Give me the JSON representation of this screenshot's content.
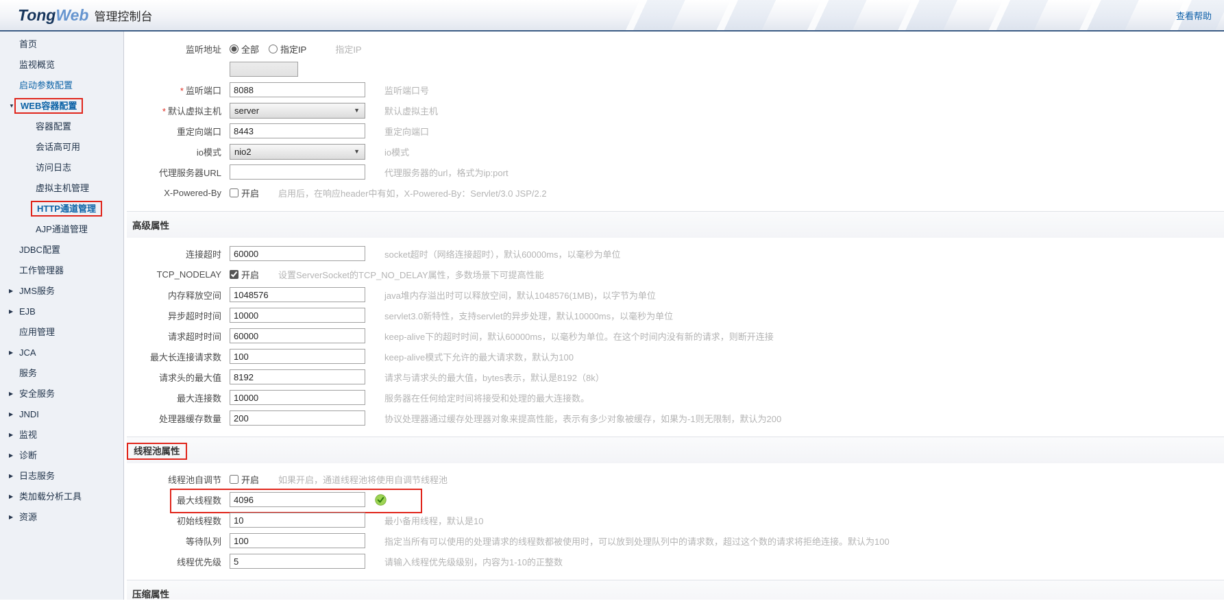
{
  "header": {
    "logo_tong": "Tong",
    "logo_web": "Web",
    "logo_suffix": "管理控制台",
    "help_link": "查看帮助"
  },
  "colors": {
    "accent_blue": "#0b62a6",
    "annotation_red": "#e0251b",
    "success_green": "#7fbf3f",
    "header_border_blue": "#3c5c85"
  },
  "sidebar": {
    "items": [
      {
        "label": "首页"
      },
      {
        "label": "监视概览"
      },
      {
        "label": "启动参数配置"
      },
      {
        "label": "WEB容器配置",
        "arrow": "▼",
        "highlighted": true
      },
      {
        "label": "容器配置"
      },
      {
        "label": "会话高可用"
      },
      {
        "label": "访问日志"
      },
      {
        "label": "虚拟主机管理"
      },
      {
        "label": "HTTP通道管理",
        "highlighted": true
      },
      {
        "label": "AJP通道管理"
      },
      {
        "label": "JDBC配置"
      },
      {
        "label": "工作管理器"
      },
      {
        "label": "JMS服务",
        "arrow": "▶"
      },
      {
        "label": "EJB",
        "arrow": "▶"
      },
      {
        "label": "应用管理"
      },
      {
        "label": "JCA",
        "arrow": "▶"
      },
      {
        "label": "服务"
      },
      {
        "label": "安全服务",
        "arrow": "▶"
      },
      {
        "label": "JNDI",
        "arrow": "▶"
      },
      {
        "label": "监视",
        "arrow": "▶"
      },
      {
        "label": "诊断",
        "arrow": "▶"
      },
      {
        "label": "日志服务",
        "arrow": "▶"
      },
      {
        "label": "类加载分析工具",
        "arrow": "▶"
      },
      {
        "label": "资源",
        "arrow": "▶"
      }
    ]
  },
  "main": {
    "groups": [
      {
        "rows": [
          {
            "label": "监听地址",
            "type": "radio",
            "help": "指定IP",
            "options": [
              {
                "label": "全部",
                "selected": true
              },
              {
                "label": "指定IP",
                "selected": false
              }
            ]
          },
          {
            "label": "",
            "type": "disabled_input",
            "value": "",
            "help": ""
          },
          {
            "label": "监听端口",
            "star": "*",
            "type": "input",
            "value": "8088",
            "help": "监听端口号"
          },
          {
            "label": "默认虚拟主机",
            "star": "*",
            "type": "select",
            "value": "server",
            "help": "默认虚拟主机"
          },
          {
            "label": "重定向端口",
            "type": "input",
            "value": "8443",
            "help": "重定向端口"
          },
          {
            "label": "io模式",
            "type": "select",
            "value": "nio2",
            "help": "io模式"
          },
          {
            "label": "代理服务器URL",
            "type": "input",
            "value": "",
            "help": "代理服务器的url，格式为ip:port"
          },
          {
            "label": "X-Powered-By",
            "type": "checkbox",
            "checkbox_label": "开启",
            "checked": false,
            "help": "启用后，在响应header中有如，X-Powered-By：Servlet/3.0 JSP/2.2"
          }
        ]
      },
      {
        "title": "高级属性",
        "rows": [
          {
            "label": "连接超时",
            "type": "input",
            "value": "60000",
            "help": "socket超时（网络连接超时），默认60000ms，以毫秒为单位"
          },
          {
            "label": "TCP_NODELAY",
            "type": "checkbox",
            "checkbox_label": "开启",
            "checked": true,
            "help": "设置ServerSocket的TCP_NO_DELAY属性，多数场景下可提高性能"
          },
          {
            "label": "内存释放空间",
            "type": "input",
            "value": "1048576",
            "help": "java堆内存溢出时可以释放空间，默认1048576(1MB)，以字节为单位"
          },
          {
            "label": "异步超时时间",
            "type": "input",
            "value": "10000",
            "help": "servlet3.0新特性，支持servlet的异步处理，默认10000ms，以毫秒为单位"
          },
          {
            "label": "请求超时时间",
            "type": "input",
            "value": "60000",
            "help": "keep-alive下的超时时间，默认60000ms，以毫秒为单位。在这个时间内没有新的请求，则断开连接"
          },
          {
            "label": "最大长连接请求数",
            "type": "input",
            "value": "100",
            "help": "keep-alive模式下允许的最大请求数，默认为100"
          },
          {
            "label": "请求头的最大值",
            "type": "input",
            "value": "8192",
            "help": "请求与请求头的最大值，bytes表示，默认是8192（8k）"
          },
          {
            "label": "最大连接数",
            "type": "input",
            "value": "10000",
            "help": "服务器在任何给定时间将接受和处理的最大连接数。"
          },
          {
            "label": "处理器缓存数量",
            "type": "input",
            "value": "200",
            "help": "协议处理器通过缓存处理器对象来提高性能，表示有多少对象被缓存，如果为-1则无限制，默认为200"
          }
        ]
      },
      {
        "title": "线程池属性",
        "title_highlighted": true,
        "rows": [
          {
            "label": "线程池自调节",
            "type": "checkbox",
            "checkbox_label": "开启",
            "checked": false,
            "help": "如果开启，通道线程池将使用自调节线程池"
          },
          {
            "label": "最大线程数",
            "type": "input",
            "value": "4096",
            "help": "",
            "valid": true,
            "highlighted": true
          },
          {
            "label": "初始线程数",
            "type": "input",
            "value": "10",
            "help": "最小备用线程，默认是10"
          },
          {
            "label": "等待队列",
            "type": "input",
            "value": "100",
            "help": "指定当所有可以使用的处理请求的线程数都被使用时，可以放到处理队列中的请求数，超过这个数的请求将拒绝连接。默认为100"
          },
          {
            "label": "线程优先级",
            "type": "input",
            "value": "5",
            "help": "请输入线程优先级级别，内容为1-10的正整数"
          }
        ]
      },
      {
        "title": "压缩属性",
        "partial": true,
        "rows": []
      }
    ]
  }
}
